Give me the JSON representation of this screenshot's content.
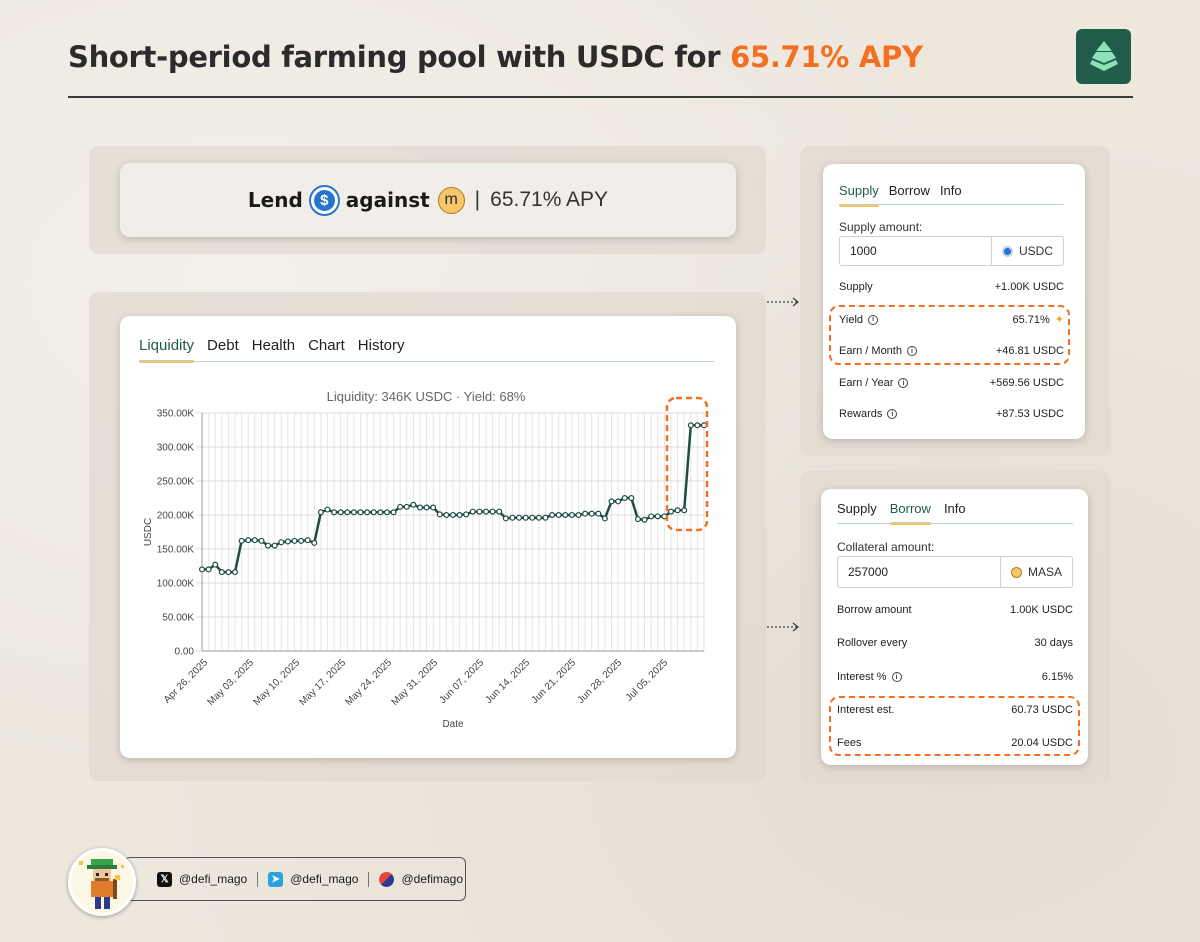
{
  "header": {
    "title_prefix": "Short-period farming pool with USDC for ",
    "title_highlight": "65.71% APY"
  },
  "lend_banner": {
    "lend": "Lend",
    "against": "against",
    "separator": "|",
    "apy": "65.71% APY"
  },
  "chart_panel": {
    "tabs": [
      "Liquidity",
      "Debt",
      "Health",
      "Chart",
      "History"
    ],
    "active_tab": "Liquidity"
  },
  "chart_data": {
    "type": "line",
    "title": "Liquidity: 346K USDC · Yield: 68%",
    "xlabel": "Date",
    "ylabel": "USDC",
    "ylim": [
      0,
      350000
    ],
    "yticks": [
      "0.00",
      "50.00K",
      "100.00K",
      "150.00K",
      "200.00K",
      "250.00K",
      "300.00K",
      "350.00K"
    ],
    "xticks": [
      "Apr 26, 2025",
      "May 03, 2025",
      "May 10, 2025",
      "May 17, 2025",
      "May 24, 2025",
      "May 31, 2025",
      "Jun 07, 2025",
      "Jun 14, 2025",
      "Jun 21, 2025",
      "Jun 28, 2025",
      "Jul 05, 2025"
    ],
    "grid": true,
    "color": "#1f4d44",
    "series": [
      {
        "values": [
          120000,
          120000,
          127000,
          116000,
          116000,
          116000,
          162000,
          163000,
          163000,
          162000,
          155000,
          155000,
          160000,
          161000,
          162000,
          162000,
          163000,
          159000,
          204000,
          208000,
          204000,
          204000,
          204000,
          204000,
          204000,
          204000,
          204000,
          204000,
          204000,
          204000,
          212000,
          212000,
          215000,
          211000,
          211000,
          211000,
          201000,
          200000,
          200000,
          200000,
          201000,
          205000,
          205000,
          205000,
          205000,
          205000,
          195000,
          196000,
          196000,
          196000,
          196000,
          196000,
          196000,
          200000,
          200000,
          200000,
          200000,
          200000,
          202000,
          202000,
          202000,
          195000,
          220000,
          220000,
          225000,
          225000,
          194000,
          193000,
          198000,
          198000,
          198000,
          205000,
          207000,
          207000,
          332000,
          332000,
          332000
        ]
      }
    ]
  },
  "supply_card": {
    "tabs": [
      "Supply",
      "Borrow",
      "Info"
    ],
    "active_tab": "Supply",
    "amount_label": "Supply amount:",
    "amount_value": "1000",
    "amount_unit": "USDC",
    "rows": [
      {
        "key": "Supply",
        "value": "+1.00K USDC",
        "info": false
      },
      {
        "key": "Yield",
        "value": "65.71%",
        "info": true
      },
      {
        "key": "Earn / Month",
        "value": "+46.81 USDC",
        "info": true
      },
      {
        "key": "Earn / Year",
        "value": "+569.56 USDC",
        "info": true
      },
      {
        "key": "Rewards",
        "value": "+87.53 USDC",
        "info": true
      }
    ]
  },
  "borrow_card": {
    "tabs": [
      "Supply",
      "Borrow",
      "Info"
    ],
    "active_tab": "Borrow",
    "amount_label": "Collateral amount:",
    "amount_value": "257000",
    "amount_unit": "MASA",
    "rows": [
      {
        "key": "Borrow amount",
        "value": "1.00K USDC",
        "info": false
      },
      {
        "key": "Rollover every",
        "value": "30 days",
        "info": false
      },
      {
        "key": "Interest %",
        "value": "6.15%",
        "info": true
      },
      {
        "key": "Interest est.",
        "value": "60.73 USDC",
        "info": false
      },
      {
        "key": "Fees",
        "value": "20.04 USDC",
        "info": false
      }
    ]
  },
  "socials": [
    {
      "icon": "x-icon",
      "handle": "@defi_mago"
    },
    {
      "icon": "telegram-icon",
      "handle": "@defi_mago"
    },
    {
      "icon": "farcaster-icon",
      "handle": "@defimago"
    }
  ],
  "colors": {
    "accent": "#f36f21",
    "brand": "#1f5c4a",
    "tab_underline": "#f5c35d",
    "line": "#1f4d44"
  }
}
